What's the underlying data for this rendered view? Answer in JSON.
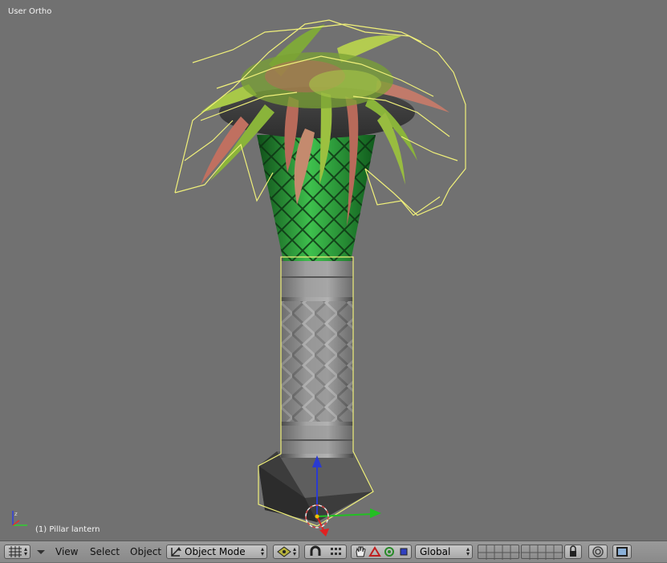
{
  "viewport": {
    "view_label": "User Ortho",
    "object_label": "(1) Pillar lantern"
  },
  "header": {
    "menus": {
      "view": "View",
      "select": "Select",
      "object": "Object"
    },
    "mode_label": "Object Mode",
    "orientation_label": "Global"
  },
  "colors": {
    "viewport_bg": "#717171",
    "selection_outline": "#f0f07a",
    "pillar_green": "#2f9a3c",
    "leaf_green": "#8ab43a",
    "leaf_red": "#b86a5a",
    "axis_x": "#22c022",
    "axis_y": "#e02020",
    "axis_z": "#2a3ad0"
  },
  "icons": [
    "editor-type-grid-icon",
    "collapse-arrow-icon",
    "object-mode-icon",
    "pivot-icon",
    "snap-magnet-icon",
    "snap-grid-icon",
    "manipulator-hand-icon",
    "manipulator-translate-icon",
    "manipulator-rotate-icon",
    "manipulator-scale-icon",
    "layer-lock-icon",
    "proportional-edit-icon",
    "render-icon"
  ]
}
